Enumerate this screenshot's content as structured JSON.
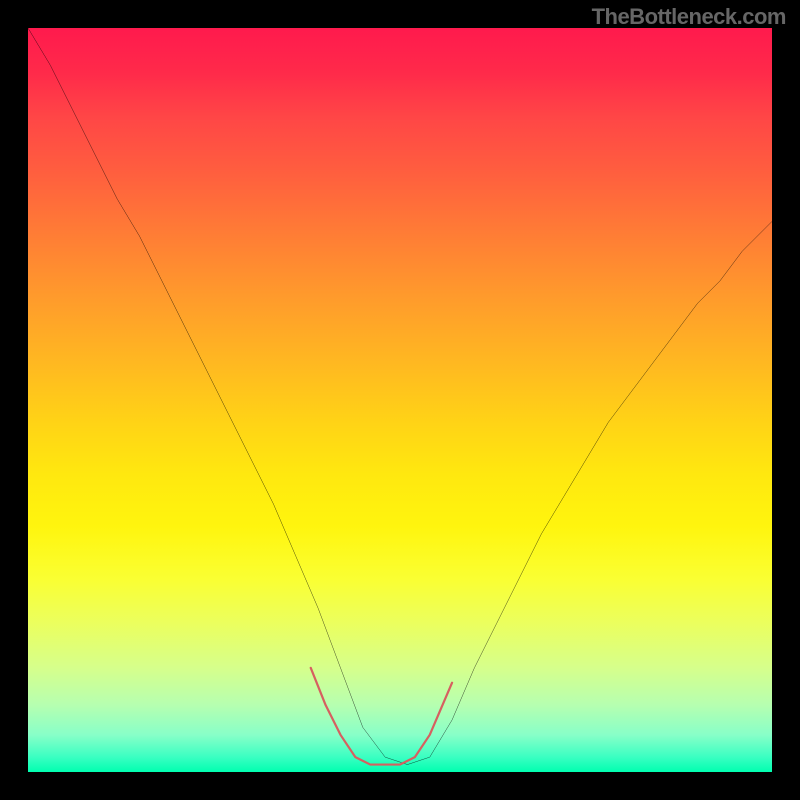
{
  "watermark": "TheBottleneck.com",
  "chart_data": {
    "type": "line",
    "title": "",
    "xlabel": "",
    "ylabel": "",
    "xlim": [
      0,
      100
    ],
    "ylim": [
      0,
      100
    ],
    "grid": false,
    "series": [
      {
        "name": "black-curve",
        "x": [
          0,
          3,
          6,
          9,
          12,
          15,
          18,
          21,
          24,
          27,
          30,
          33,
          36,
          39,
          42,
          45,
          48,
          51,
          54,
          57,
          60,
          63,
          66,
          69,
          72,
          75,
          78,
          81,
          84,
          87,
          90,
          93,
          96,
          100
        ],
        "y": [
          100,
          95,
          89,
          83,
          77,
          72,
          66,
          60,
          54,
          48,
          42,
          36,
          29,
          22,
          14,
          6,
          2,
          1,
          2,
          7,
          14,
          20,
          26,
          32,
          37,
          42,
          47,
          51,
          55,
          59,
          63,
          66,
          70,
          74
        ],
        "color": "#000000"
      },
      {
        "name": "red-u-band",
        "x": [
          38,
          40,
          42,
          44,
          46,
          48,
          50,
          52,
          54,
          57
        ],
        "y": [
          14,
          9,
          5,
          2,
          1,
          1,
          1,
          2,
          5,
          12
        ],
        "color": "#d66060"
      }
    ],
    "legend": false
  },
  "colors": {
    "black_curve": "#000000",
    "red_band": "#d66060",
    "background_frame": "#000000"
  }
}
